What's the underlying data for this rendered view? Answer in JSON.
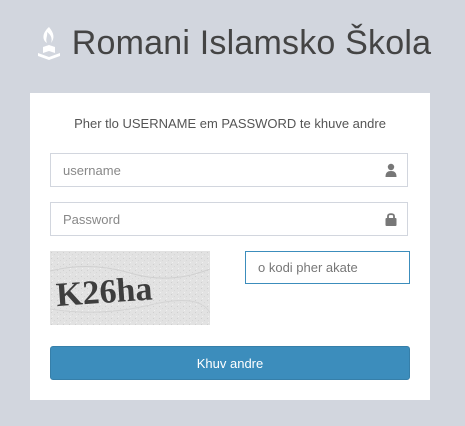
{
  "header": {
    "title": "Romani Islamsko Škola",
    "logo_icon": "book-lamp-icon"
  },
  "login": {
    "subtitle": "Pher tlo USERNAME em PASSWORD te khuve andre",
    "username": {
      "value": "",
      "placeholder": "username",
      "icon": "user-icon"
    },
    "password": {
      "value": "",
      "placeholder": "Password",
      "icon": "lock-icon"
    },
    "captcha": {
      "image_text": "K26ha",
      "value": "",
      "placeholder": "o kodi pher akate"
    },
    "submit_label": "Khuv andre"
  },
  "colors": {
    "background": "#d2d6de",
    "card": "#ffffff",
    "primary": "#3c8dbc",
    "title_text": "#444444",
    "icon": "#777777"
  }
}
